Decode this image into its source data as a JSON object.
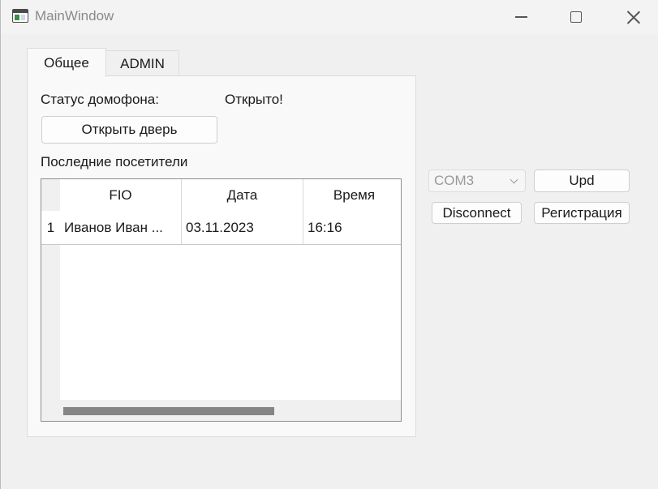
{
  "window": {
    "title": "MainWindow",
    "icons": {
      "app": "window-app-icon",
      "minimize": "minimize-icon",
      "maximize": "maximize-icon",
      "close": "close-icon"
    }
  },
  "tabs": [
    {
      "label": "Общее",
      "active": true
    },
    {
      "label": "ADMIN",
      "active": false
    }
  ],
  "general": {
    "status_label": "Статус домофона:",
    "status_value": "Открыто!",
    "open_door_label": "Открыть дверь",
    "visitors_label": "Последние посетители"
  },
  "table": {
    "headers": [
      "FIO",
      "Дата",
      "Время"
    ],
    "rows": [
      {
        "num": "1",
        "fio": "Иванов Иван ...",
        "date": "03.11.2023",
        "time": "16:16"
      }
    ]
  },
  "controls": {
    "com_port": "COM3",
    "upd_label": "Upd",
    "disconnect_label": "Disconnect",
    "register_label": "Регистрация"
  }
}
